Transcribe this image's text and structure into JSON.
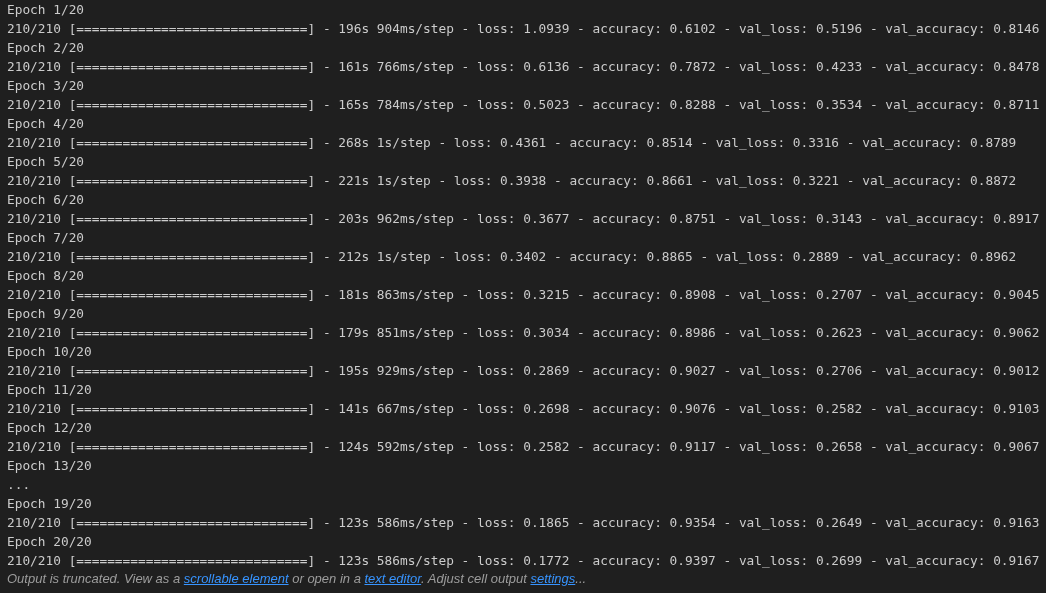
{
  "output_lines": [
    "Epoch 1/20",
    "210/210 [==============================] - 196s 904ms/step - loss: 1.0939 - accuracy: 0.6102 - val_loss: 0.5196 - val_accuracy: 0.8146",
    "Epoch 2/20",
    "210/210 [==============================] - 161s 766ms/step - loss: 0.6136 - accuracy: 0.7872 - val_loss: 0.4233 - val_accuracy: 0.8478",
    "Epoch 3/20",
    "210/210 [==============================] - 165s 784ms/step - loss: 0.5023 - accuracy: 0.8288 - val_loss: 0.3534 - val_accuracy: 0.8711",
    "Epoch 4/20",
    "210/210 [==============================] - 268s 1s/step - loss: 0.4361 - accuracy: 0.8514 - val_loss: 0.3316 - val_accuracy: 0.8789",
    "Epoch 5/20",
    "210/210 [==============================] - 221s 1s/step - loss: 0.3938 - accuracy: 0.8661 - val_loss: 0.3221 - val_accuracy: 0.8872",
    "Epoch 6/20",
    "210/210 [==============================] - 203s 962ms/step - loss: 0.3677 - accuracy: 0.8751 - val_loss: 0.3143 - val_accuracy: 0.8917",
    "Epoch 7/20",
    "210/210 [==============================] - 212s 1s/step - loss: 0.3402 - accuracy: 0.8865 - val_loss: 0.2889 - val_accuracy: 0.8962",
    "Epoch 8/20",
    "210/210 [==============================] - 181s 863ms/step - loss: 0.3215 - accuracy: 0.8908 - val_loss: 0.2707 - val_accuracy: 0.9045",
    "Epoch 9/20",
    "210/210 [==============================] - 179s 851ms/step - loss: 0.3034 - accuracy: 0.8986 - val_loss: 0.2623 - val_accuracy: 0.9062",
    "Epoch 10/20",
    "210/210 [==============================] - 195s 929ms/step - loss: 0.2869 - accuracy: 0.9027 - val_loss: 0.2706 - val_accuracy: 0.9012",
    "Epoch 11/20",
    "210/210 [==============================] - 141s 667ms/step - loss: 0.2698 - accuracy: 0.9076 - val_loss: 0.2582 - val_accuracy: 0.9103",
    "Epoch 12/20",
    "210/210 [==============================] - 124s 592ms/step - loss: 0.2582 - accuracy: 0.9117 - val_loss: 0.2658 - val_accuracy: 0.9067",
    "Epoch 13/20",
    "...",
    "Epoch 19/20",
    "210/210 [==============================] - 123s 586ms/step - loss: 0.1865 - accuracy: 0.9354 - val_loss: 0.2649 - val_accuracy: 0.9163",
    "Epoch 20/20",
    "210/210 [==============================] - 123s 586ms/step - loss: 0.1772 - accuracy: 0.9397 - val_loss: 0.2699 - val_accuracy: 0.9167"
  ],
  "truncation_notice": [
    {
      "kind": "text",
      "text": "Output is truncated. View as a "
    },
    {
      "kind": "link",
      "text": "scrollable element"
    },
    {
      "kind": "text",
      "text": " or open in a "
    },
    {
      "kind": "link",
      "text": "text editor"
    },
    {
      "kind": "text",
      "text": ". Adjust cell output "
    },
    {
      "kind": "link",
      "text": "settings"
    },
    {
      "kind": "text",
      "text": "..."
    }
  ]
}
